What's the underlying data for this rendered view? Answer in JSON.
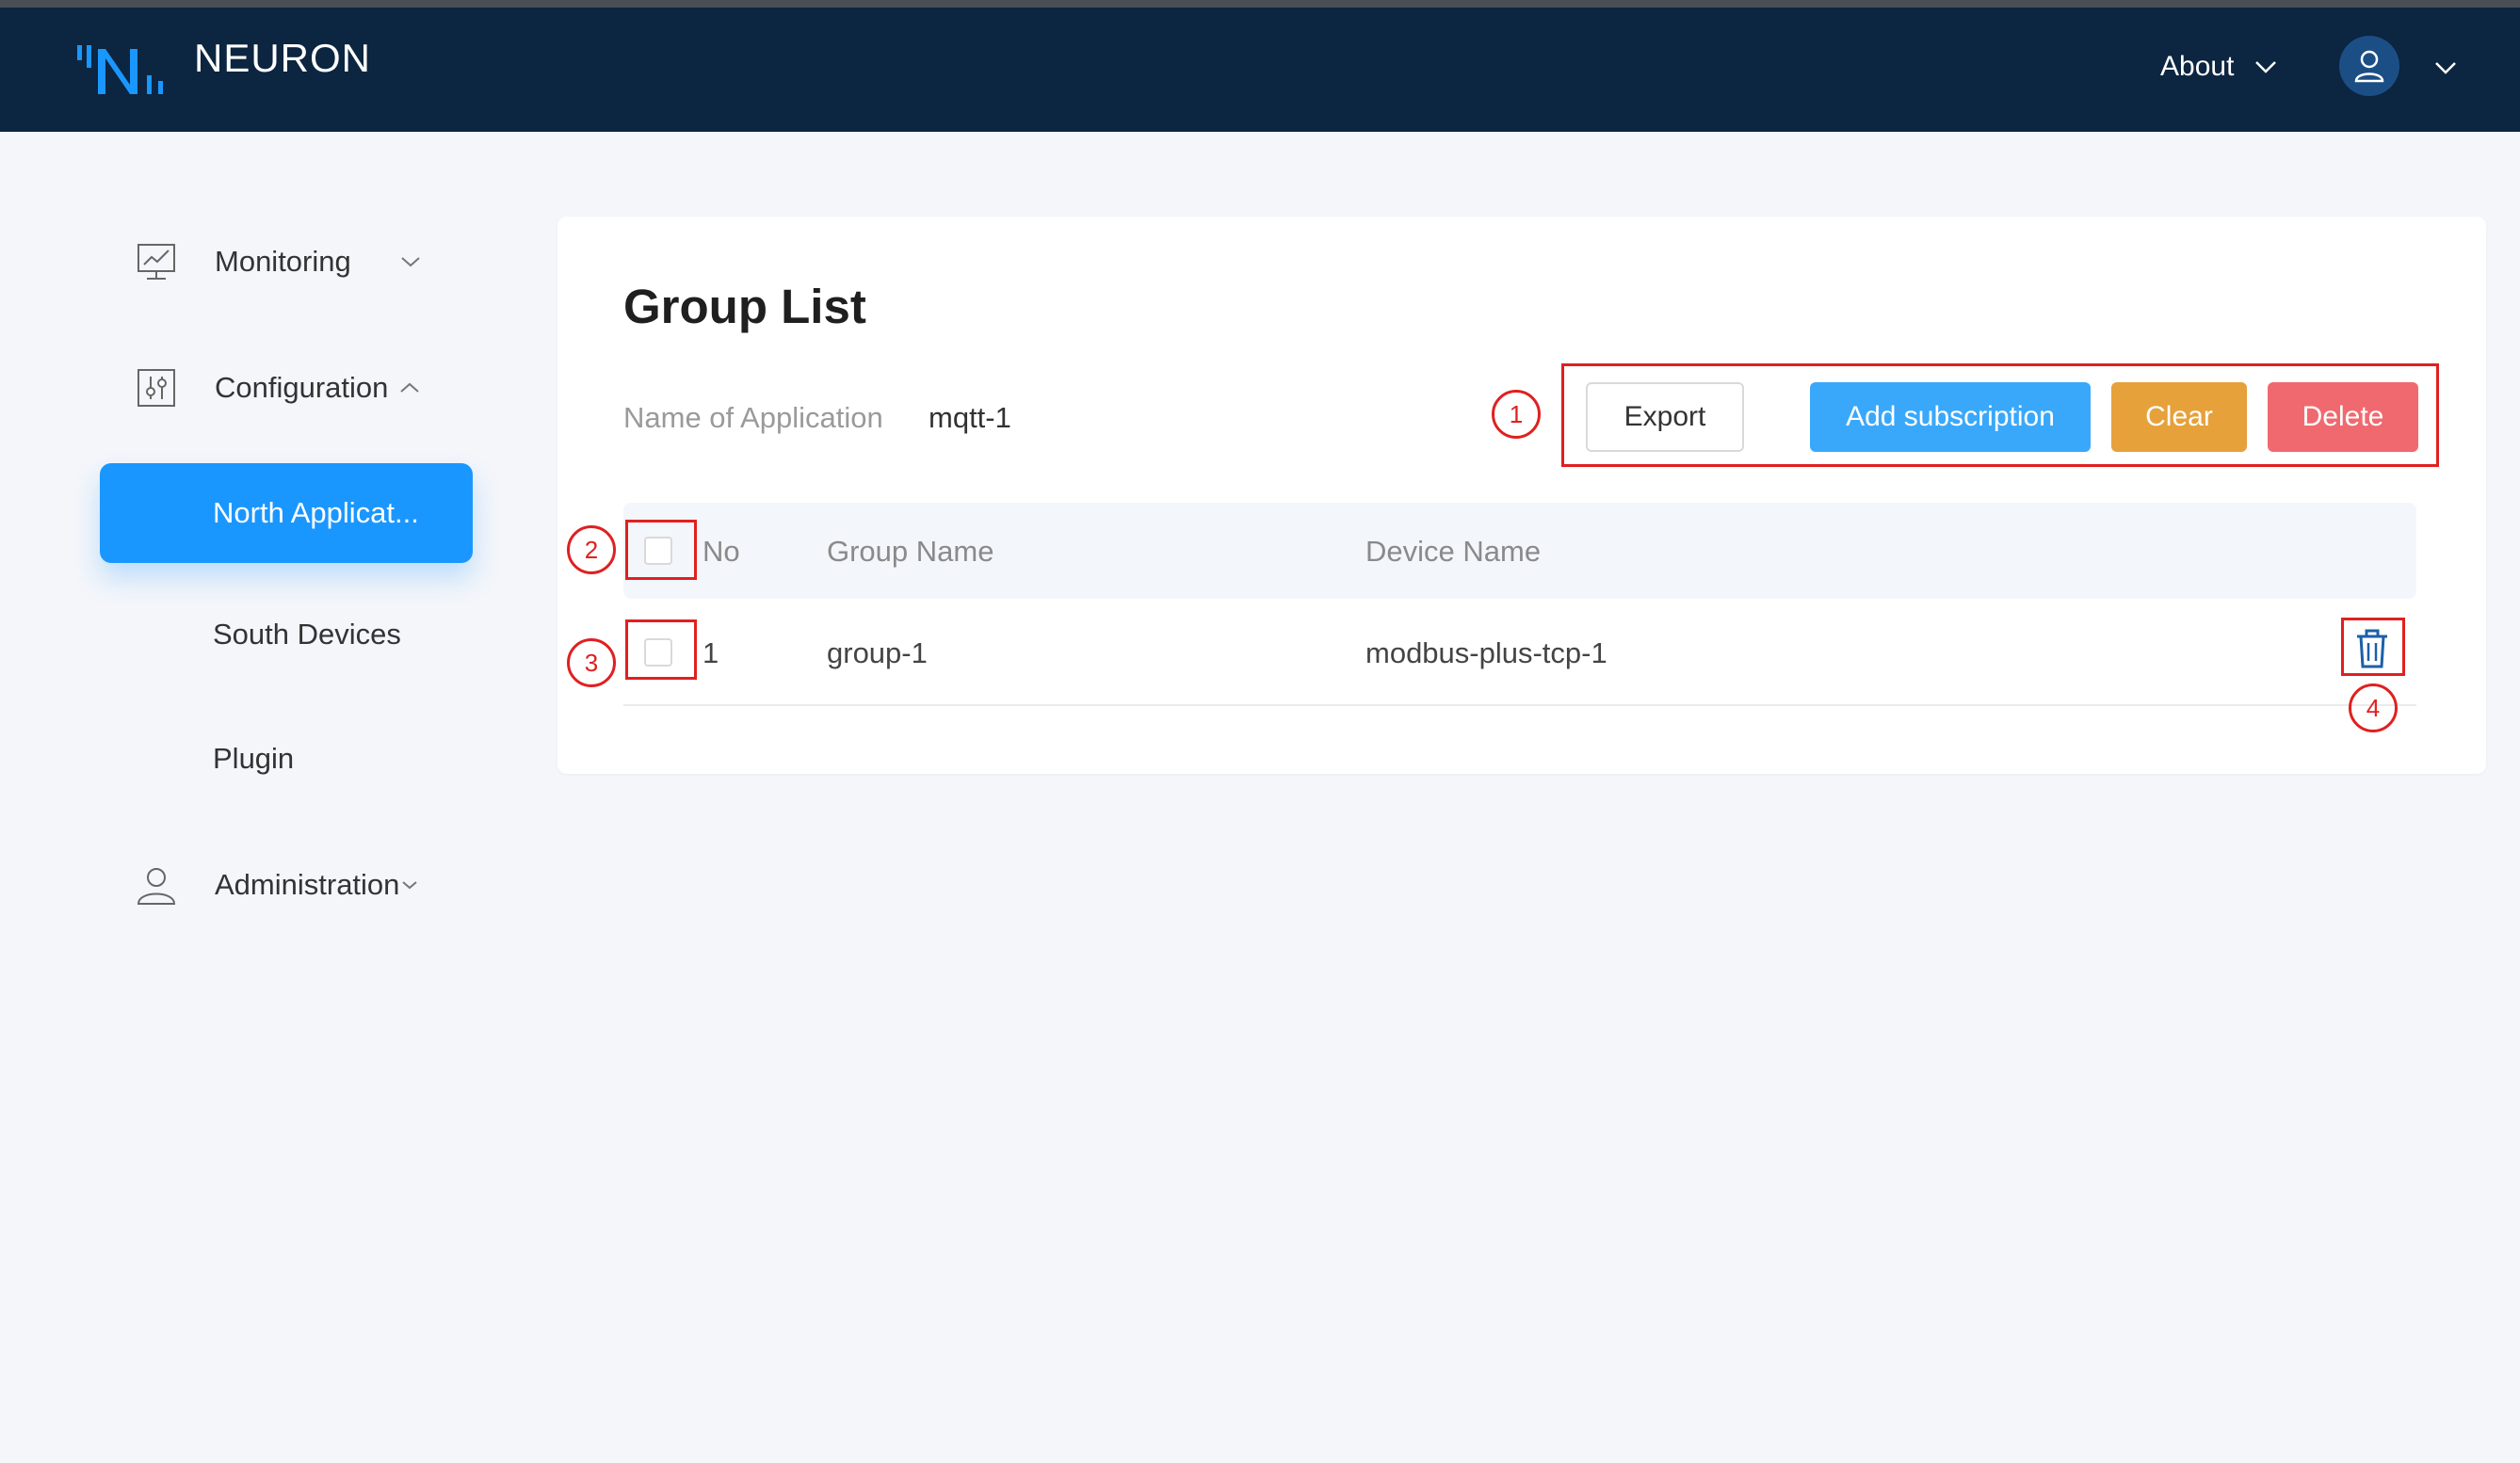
{
  "header": {
    "brand": "NEURON",
    "about_label": "About",
    "logo_icon": "neuron-logo-icon",
    "user_icon": "user-icon",
    "colors": {
      "bar": "#0c2540",
      "logo": "#1a97ff"
    }
  },
  "sidebar": {
    "monitoring": {
      "label": "Monitoring",
      "icon": "chart-monitor-icon",
      "expand": "chevron-down-icon"
    },
    "configuration": {
      "label": "Configuration",
      "icon": "sliders-icon",
      "expand": "chevron-up-icon",
      "items": [
        {
          "label": "North Applicat...",
          "active": true
        },
        {
          "label": "South Devices",
          "active": false
        },
        {
          "label": "Plugin",
          "active": false
        }
      ]
    },
    "administration": {
      "label": "Administration",
      "icon": "user-icon",
      "expand": "chevron-down-icon"
    }
  },
  "main": {
    "title": "Group List",
    "app_label": "Name of Application",
    "app_value": "mqtt-1",
    "buttons": {
      "export": "Export",
      "add_subscription": "Add subscription",
      "clear": "Clear",
      "delete": "Delete"
    },
    "button_colors": {
      "add": "#3aa8fa",
      "clear": "#e6a13a",
      "delete": "#f0696f"
    },
    "table": {
      "columns": [
        "No",
        "Group Name",
        "Device Name"
      ],
      "rows": [
        {
          "no": "1",
          "group_name": "group-1",
          "device_name": "modbus-plus-tcp-1",
          "action_icon": "trash-icon"
        }
      ]
    }
  },
  "annotations": [
    "1",
    "2",
    "3",
    "4"
  ],
  "annotation_color": "#e02020"
}
